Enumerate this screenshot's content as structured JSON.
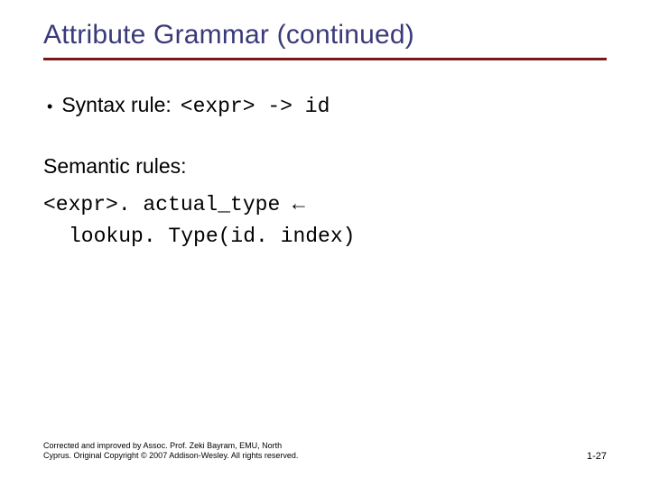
{
  "title": {
    "main": "Attribute Grammar ",
    "cont": "(continued)"
  },
  "syntax": {
    "label": "Syntax rule: ",
    "code": "<expr> -> id"
  },
  "semantic": {
    "heading": "Semantic rules:",
    "line1": "<expr>. actual_type ←",
    "line2": "lookup. Type(id. index)"
  },
  "footer": {
    "left_l1": "Corrected and improved by Assoc. Prof. Zeki Bayram, EMU, North",
    "left_l2": "Cyprus. Original Copyright © 2007 Addison-Wesley. All rights reserved.",
    "right": "1-27"
  }
}
